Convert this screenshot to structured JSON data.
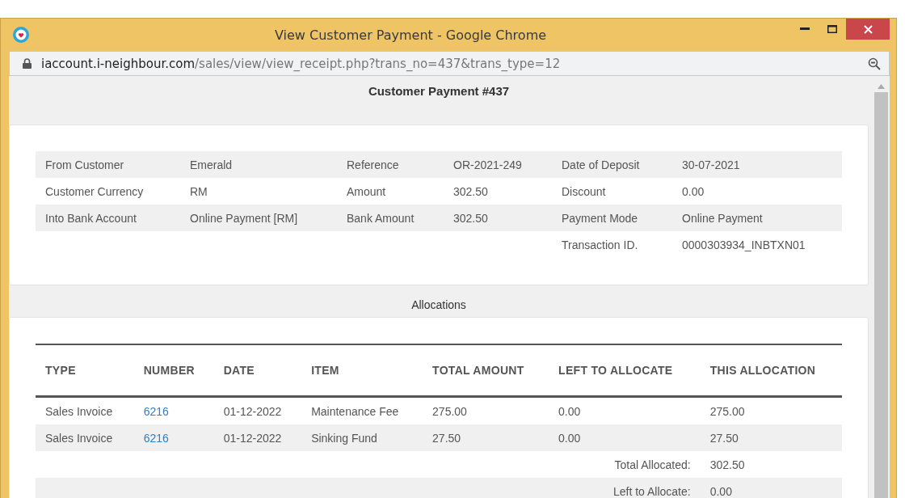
{
  "window": {
    "title": "View Customer Payment - Google Chrome"
  },
  "address_bar": {
    "domain": "iaccount.i-neighbour.com",
    "path": "/sales/view/view_receipt.php?trans_no=437&trans_type=12"
  },
  "page_title": "Customer Payment #437",
  "info": {
    "rows": [
      {
        "fields": [
          {
            "label": "From Customer",
            "value": "Emerald"
          },
          {
            "label": "Reference",
            "value": "OR-2021-249"
          },
          {
            "label": "Date of Deposit",
            "value": "30-07-2021"
          }
        ]
      },
      {
        "fields": [
          {
            "label": "Customer Currency",
            "value": "RM"
          },
          {
            "label": "Amount",
            "value": "302.50"
          },
          {
            "label": "Discount",
            "value": "0.00"
          }
        ]
      },
      {
        "fields": [
          {
            "label": "Into Bank Account",
            "value": "Online Payment [RM]"
          },
          {
            "label": "Bank Amount",
            "value": "302.50"
          },
          {
            "label": "Payment Mode",
            "value": "Online Payment"
          }
        ]
      },
      {
        "fields": [
          {
            "label": "Transaction ID.",
            "value": "0000303934_INBTXN01"
          }
        ]
      }
    ]
  },
  "allocations": {
    "title": "Allocations",
    "columns": [
      "TYPE",
      "NUMBER",
      "DATE",
      "ITEM",
      "TOTAL AMOUNT",
      "LEFT TO ALLOCATE",
      "THIS ALLOCATION"
    ],
    "rows": [
      {
        "kind": "line",
        "type": "Sales Invoice",
        "number": "6216",
        "date": "01-12-2022",
        "item": "Maintenance Fee",
        "total_amount": "275.00",
        "left_to_allocate": "0.00",
        "this_allocation": "275.00"
      },
      {
        "kind": "line",
        "type": "Sales Invoice",
        "number": "6216",
        "date": "01-12-2022",
        "item": "Sinking Fund",
        "total_amount": "27.50",
        "left_to_allocate": "0.00",
        "this_allocation": "27.50"
      },
      {
        "kind": "total",
        "label": "Total Allocated:",
        "value": "302.50"
      },
      {
        "kind": "total",
        "label": "Left to Allocate:",
        "value": "0.00"
      }
    ]
  }
}
